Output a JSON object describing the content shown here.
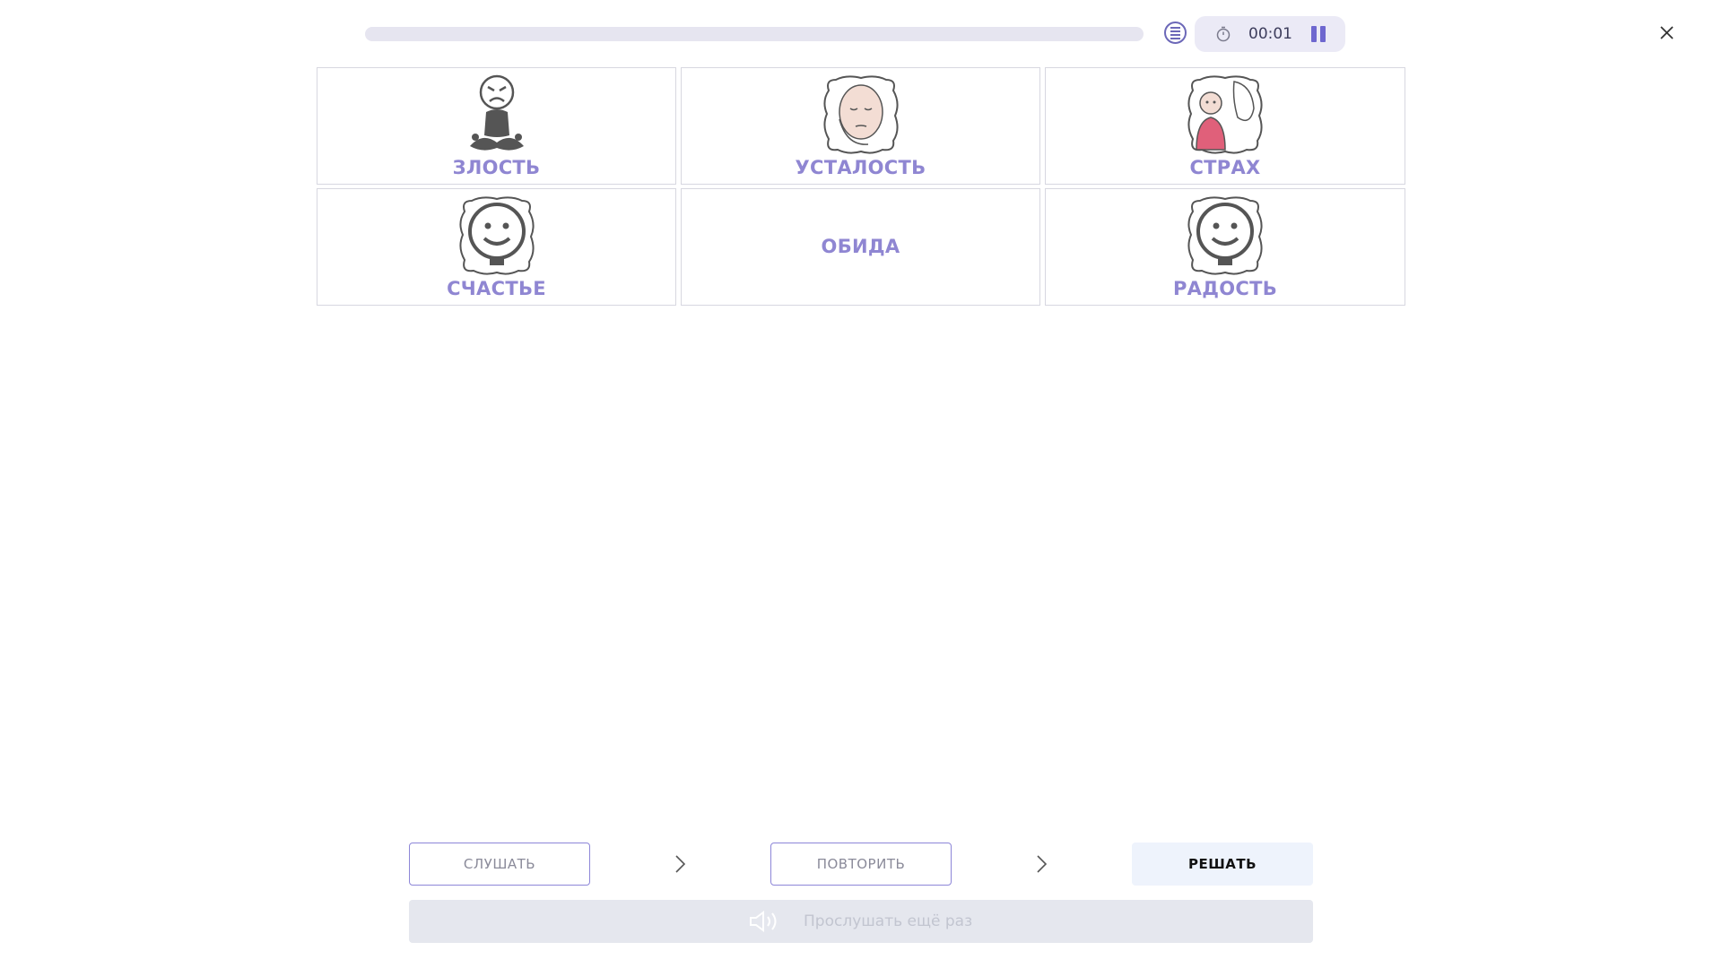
{
  "header": {
    "progress": 0.0,
    "timer": "00:01",
    "accent": "#6e67cf"
  },
  "cards": [
    {
      "label": "ЗЛОСТЬ",
      "icon": "angry-person-icon"
    },
    {
      "label": "УСТАЛОСТЬ",
      "icon": "tired-face-icon"
    },
    {
      "label": "СТРАХ",
      "icon": "scared-person-icon"
    },
    {
      "label": "СЧАСТЬЕ",
      "icon": "smiley-face-icon"
    },
    {
      "label": "ОБИДА",
      "icon": null
    },
    {
      "label": "РАДОСТЬ",
      "icon": "smiley-face-icon"
    }
  ],
  "steps": {
    "listen": "СЛУШАТЬ",
    "repeat": "ПОВТОРИТЬ",
    "solve": "РЕШАТЬ"
  },
  "listen_again": {
    "label": "Прослушать ещё раз",
    "icon": "speaker-icon"
  },
  "colors": {
    "label": "#8f86d2",
    "button_border": "#8d86d8",
    "solve_bg": "#eef3fc",
    "listen_again_bg": "#e5e7ee"
  }
}
